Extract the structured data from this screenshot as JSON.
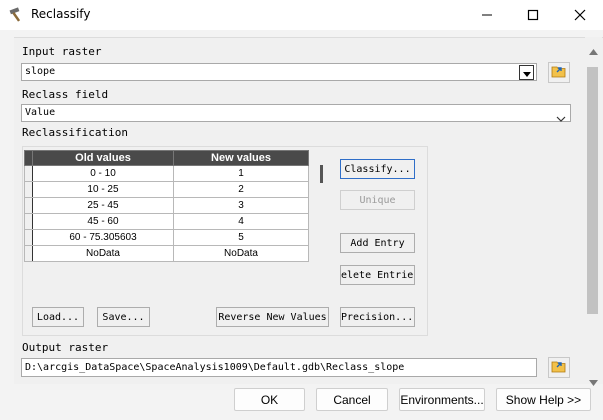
{
  "window": {
    "title": "Reclassify",
    "icon": "hammer-icon",
    "controls": [
      "minimize-icon",
      "maximize-icon",
      "close-icon"
    ]
  },
  "form": {
    "input_raster": {
      "label": "Input raster",
      "value": "slope"
    },
    "reclass_field": {
      "label": "Reclass field",
      "value": "Value"
    },
    "reclassification": {
      "label": "Reclassification",
      "columns": [
        "Old values",
        "New values"
      ],
      "rows": [
        {
          "old": "0 - 10",
          "new": "1"
        },
        {
          "old": "10 - 25",
          "new": "2"
        },
        {
          "old": "25 - 45",
          "new": "3"
        },
        {
          "old": "45 - 60",
          "new": "4"
        },
        {
          "old": "60 - 75.305603",
          "new": "5"
        },
        {
          "old": "NoData",
          "new": "NoData"
        }
      ],
      "buttons": {
        "classify": "Classify...",
        "unique": "Unique",
        "add_entry": "Add Entry",
        "delete_entries": "elete Entrie",
        "load": "Load...",
        "save": "Save...",
        "reverse": "Reverse New Values",
        "precision": "Precision..."
      }
    },
    "output_raster": {
      "label": "Output raster",
      "value": "D:\\arcgis_DataSpace\\SpaceAnalysis1009\\Default.gdb\\Reclass_slope"
    }
  },
  "footer": {
    "ok": "OK",
    "cancel": "Cancel",
    "environments": "Environments...",
    "show_help": "Show Help >>"
  },
  "colors": {
    "table_header": "#4a4a4a",
    "focus_border": "#2f6ec8",
    "folder_icon": "#e3a21a"
  }
}
